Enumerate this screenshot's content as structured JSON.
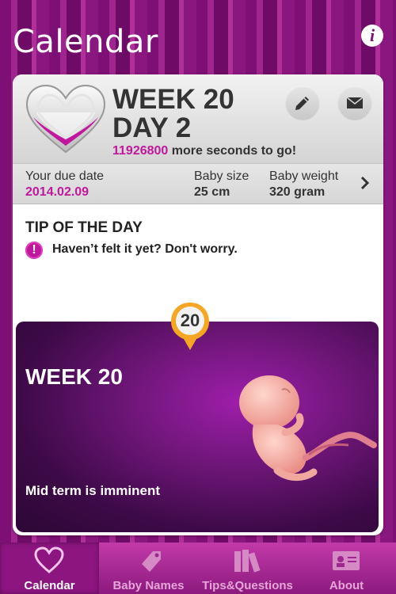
{
  "header": {
    "title": "Calendar",
    "info_icon": "i"
  },
  "pregnancy": {
    "week_label": "WEEK 20",
    "day_label": "DAY 2",
    "seconds_value": "11926800",
    "seconds_suffix": "more seconds to go!"
  },
  "details": {
    "due_date_label": "Your due date",
    "due_date_value": "2014.02.09",
    "baby_size_label": "Baby size",
    "baby_size_value": "25 cm",
    "baby_weight_label": "Baby weight",
    "baby_weight_value": "320 gram"
  },
  "tip": {
    "title": "TIP OF THE DAY",
    "icon_glyph": "!",
    "text": "Haven’t felt it yet? Don't worry."
  },
  "week_card": {
    "badge_number": "20",
    "title": "WEEK 20",
    "subtitle": "Mid term is imminent"
  },
  "tabs": [
    {
      "label": "Calendar",
      "icon": "heart-icon",
      "active": true
    },
    {
      "label": "Baby Names",
      "icon": "tag-icon",
      "active": false
    },
    {
      "label": "Tips&Questions",
      "icon": "books-icon",
      "active": false
    },
    {
      "label": "About",
      "icon": "contact-card-icon",
      "active": false
    }
  ],
  "colors": {
    "accent": "#c0189d",
    "background": "#7e0f74",
    "tabbar": "#a8289a"
  }
}
